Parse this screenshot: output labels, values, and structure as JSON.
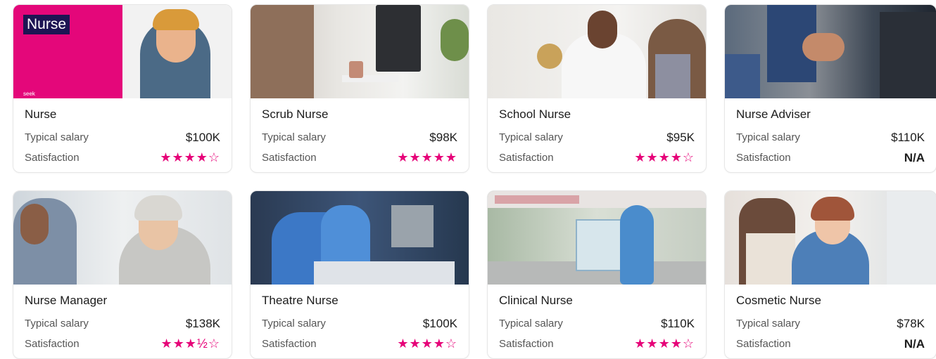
{
  "cards": [
    {
      "title": "Nurse",
      "salary_label": "Typical salary",
      "salary": "$100K",
      "satisfaction_label": "Satisfaction",
      "stars": "★★★★☆",
      "badge": "Nurse",
      "badge_sub": "seek"
    },
    {
      "title": "Scrub Nurse",
      "salary_label": "Typical salary",
      "salary": "$98K",
      "satisfaction_label": "Satisfaction",
      "stars": "★★★★★"
    },
    {
      "title": "School Nurse",
      "salary_label": "Typical salary",
      "salary": "$95K",
      "satisfaction_label": "Satisfaction",
      "stars": "★★★★☆"
    },
    {
      "title": "Nurse Adviser",
      "salary_label": "Typical salary",
      "salary": "$110K",
      "satisfaction_label": "Satisfaction",
      "rating": "N/A"
    },
    {
      "title": "Nurse Manager",
      "salary_label": "Typical salary",
      "salary": "$138K",
      "satisfaction_label": "Satisfaction",
      "stars": "★★★½☆"
    },
    {
      "title": "Theatre Nurse",
      "salary_label": "Typical salary",
      "salary": "$100K",
      "satisfaction_label": "Satisfaction",
      "stars": "★★★★☆"
    },
    {
      "title": "Clinical Nurse",
      "salary_label": "Typical salary",
      "salary": "$110K",
      "satisfaction_label": "Satisfaction",
      "stars": "★★★★☆"
    },
    {
      "title": "Cosmetic Nurse",
      "salary_label": "Typical salary",
      "salary": "$78K",
      "satisfaction_label": "Satisfaction",
      "rating": "N/A"
    }
  ],
  "colors": {
    "accent": "#e60278",
    "text": "#1c1c1c",
    "muted": "#555555",
    "border": "#e6e6e6"
  }
}
